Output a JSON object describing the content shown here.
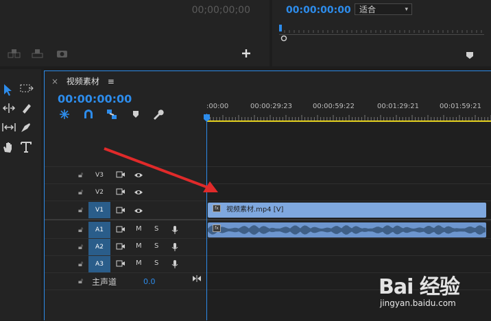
{
  "source_monitor": {
    "timecode": "00;00;00;00"
  },
  "program_monitor": {
    "timecode": "00:00:00:00",
    "fit_select": {
      "value": "适合"
    }
  },
  "sequence": {
    "close_glyph": "×",
    "name": "视频素材",
    "menu_glyph": "≡",
    "timecode": "00:00:00:00",
    "ruler_labels": [
      ":00:00",
      "00:00:29:23",
      "00:00:59:22",
      "00:01:29:21",
      "00:01:59:21"
    ]
  },
  "tracks": {
    "video": [
      {
        "target": "V3",
        "active": false
      },
      {
        "target": "V2",
        "active": false
      },
      {
        "target": "V1",
        "active": true
      }
    ],
    "audio": [
      {
        "target": "A1",
        "active": true,
        "mute": "M",
        "solo": "S"
      },
      {
        "target": "A2",
        "active": true,
        "mute": "M",
        "solo": "S"
      },
      {
        "target": "A3",
        "active": true,
        "mute": "M",
        "solo": "S"
      }
    ],
    "master": {
      "label": "主声道",
      "value": "0.0"
    }
  },
  "clips": {
    "video_fx": "fx",
    "video_label": "视频素材.mp4 [V]",
    "audio_fx": "fx"
  },
  "annotation": {
    "arrow_color": "#e02a2a"
  },
  "watermark": {
    "brand": "Bai 经验",
    "url": "jingyan.baidu.com"
  },
  "colors": {
    "accent": "#2d8ceb",
    "work_area": "#e6d31e",
    "clip_video": "#7fa8df",
    "clip_audio": "#6d96cf"
  }
}
